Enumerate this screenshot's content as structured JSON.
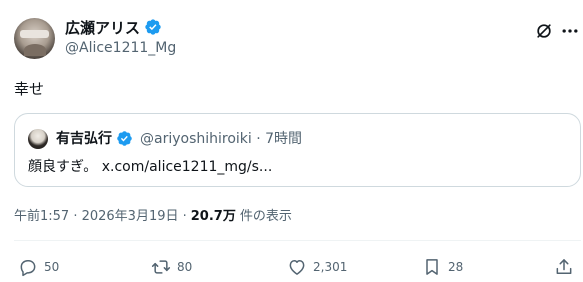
{
  "post": {
    "author_name": "広瀬アリス",
    "author_handle": "@Alice1211_Mg",
    "text": "幸せ"
  },
  "quote": {
    "author_name": "有吉弘行",
    "author_handle": "@ariyoshihiroiki · 7時間",
    "text": "顔良すぎ。 x.com/alice1211_mg/s..."
  },
  "meta": {
    "timestamp": "午前1:57 · 2026年3月19日 ·",
    "views_count": "20.7万",
    "views_label": "件の表示"
  },
  "actions": {
    "replies": "50",
    "reposts": "80",
    "likes": "2,301",
    "bookmarks": "28"
  },
  "icons": {
    "verified": "verified-badge-icon",
    "grok": "grok-icon",
    "more": "more-icon",
    "reply": "reply-icon",
    "repost": "repost-icon",
    "like": "heart-icon",
    "bookmark": "bookmark-icon",
    "share": "share-icon"
  },
  "colors": {
    "verified_blue": "#1d9bf0",
    "secondary_text": "#536471",
    "primary_text": "#0f1419"
  }
}
